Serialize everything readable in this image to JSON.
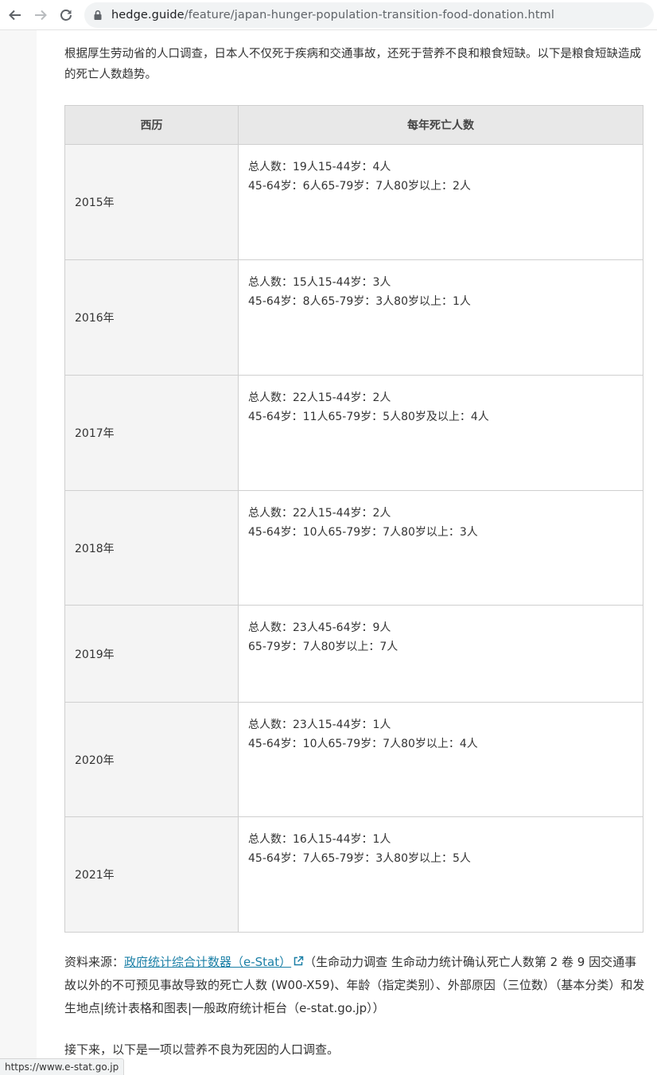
{
  "browser": {
    "url_host": "hedge.guide",
    "url_path": "/feature/japan-hunger-population-transition-food-donation.html",
    "status_url": "https://www.e-stat.go.jp"
  },
  "article": {
    "intro": "根据厚生劳动省的人口调查，日本人不仅死于疾病和交通事故，还死于营养不良和粮食短缺。以下是粮食短缺造成的死亡人数趋势。",
    "table": {
      "headers": [
        "西历",
        "每年死亡人数"
      ],
      "rows": [
        {
          "year": "2015年",
          "line1": "总人数：19人15-44岁：4人",
          "line2": "45-64岁：6人65-79岁：7人80岁以上：2人"
        },
        {
          "year": "2016年",
          "line1": "总人数：15人15-44岁：3人",
          "line2": "45-64岁：8人65-79岁：3人80岁以上：1人"
        },
        {
          "year": "2017年",
          "line1": "总人数：22人15-44岁：2人",
          "line2": "45-64岁：11人65-79岁：5人80岁及以上：4人"
        },
        {
          "year": "2018年",
          "line1": "总人数：22人15-44岁：2人",
          "line2": "45-64岁：10人65-79岁：7人80岁以上：3人"
        },
        {
          "year": "2019年",
          "line1": "总人数：23人45-64岁：9人",
          "line2": "65-79岁：7人80岁以上：7人"
        },
        {
          "year": "2020年",
          "line1": "总人数：23人15-44岁：1人",
          "line2": "45-64岁：10人65-79岁：7人80岁以上：4人"
        },
        {
          "year": "2021年",
          "line1": "总人数：16人15-44岁：1人",
          "line2": "45-64岁：7人65-79岁：3人80岁以上：5人"
        }
      ]
    },
    "source_prefix": "资料来源：",
    "source_link": "政府统计综合计数器（e-Stat）",
    "source_rest": "（生命动力调查 生命动力统计确认死亡人数第 2 卷 9 因交通事故以外的不可预见事故导致的死亡人数 (W00-X59)、年龄（指定类别）、外部原因（三位数）（基本分类）和发生地点|统计表格和图表|一般政府统计柜台（e-stat.go.jp））",
    "next_paragraph": "接下来，以下是一项以营养不良为死因的人口调查。"
  }
}
